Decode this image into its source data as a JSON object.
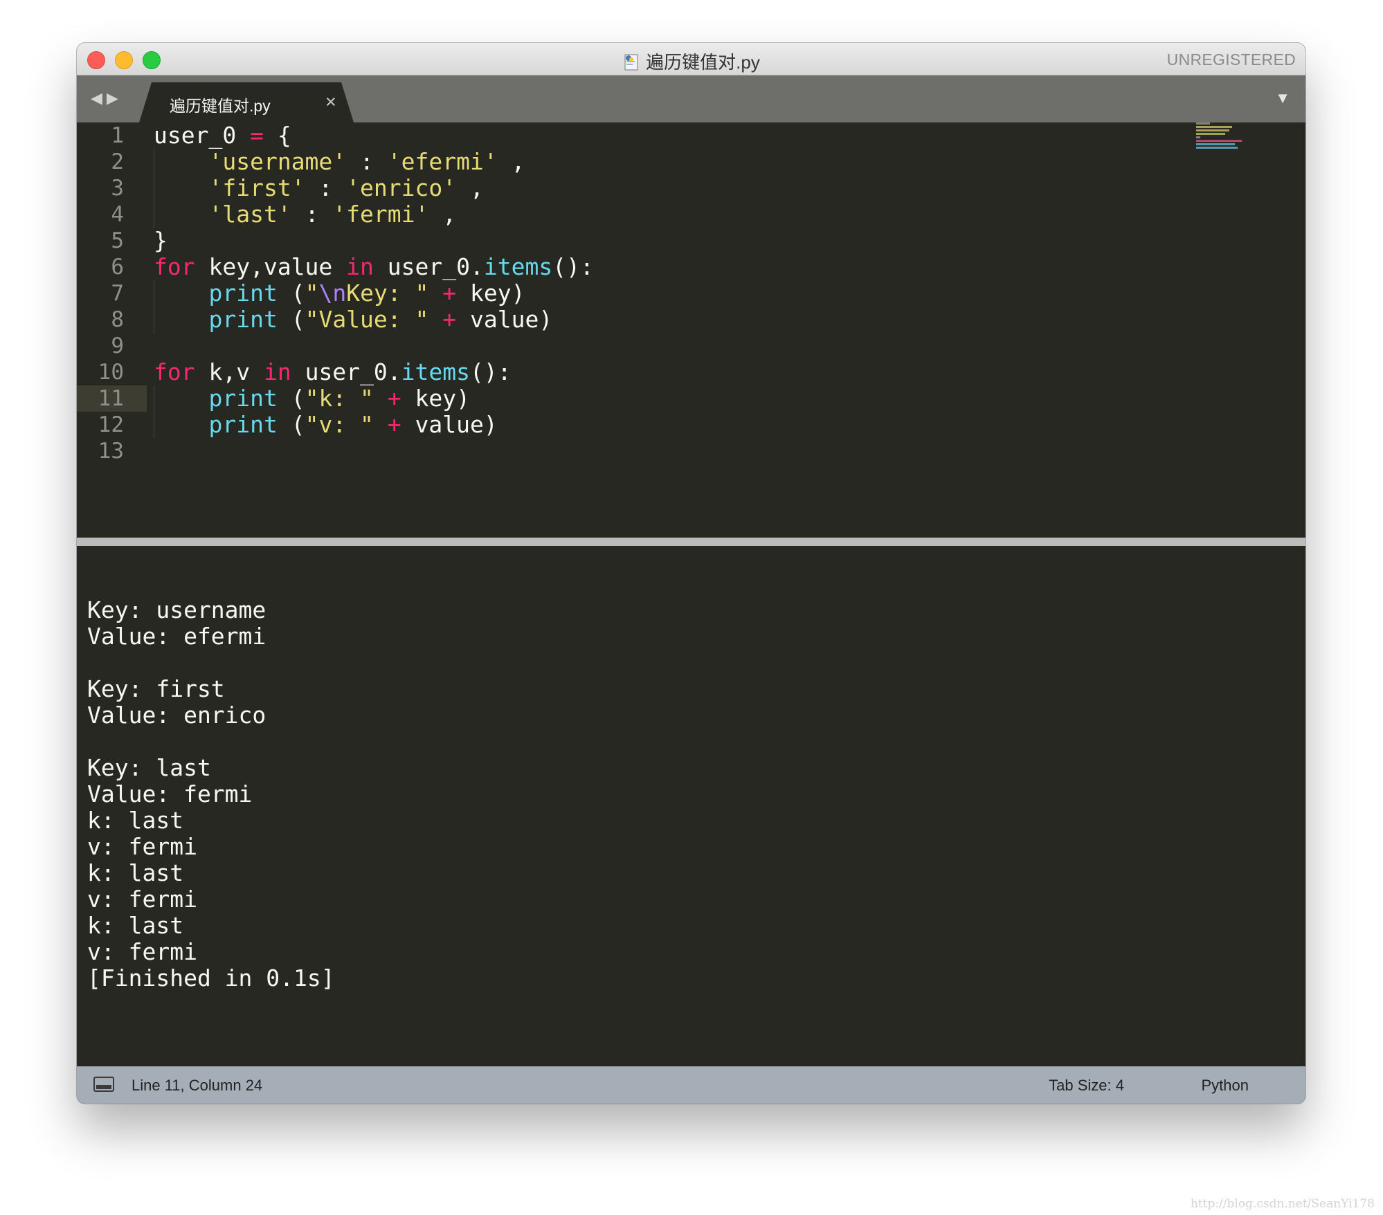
{
  "window": {
    "title": "遍历键值对.py",
    "license_status": "UNREGISTERED"
  },
  "tabs": [
    {
      "label": "遍历键值对.py",
      "active": true
    }
  ],
  "editor": {
    "syntax": "Python",
    "line_numbers": [
      "1",
      "2",
      "3",
      "4",
      "5",
      "6",
      "7",
      "8",
      "9",
      "10",
      "11",
      "12",
      "13"
    ],
    "active_line": 11,
    "colors": {
      "background": "#272822",
      "keyword": "#f92672",
      "string": "#e6db74",
      "builtin": "#66d9ef",
      "escape": "#ae81ff",
      "text": "#f8f8f2"
    },
    "lines": [
      "user_0 = {",
      "    'username' : 'efermi' ,",
      "    'first' : 'enrico' ,",
      "    'last' : 'fermi' ,",
      "}",
      "for key,value in user_0.items():",
      "    print (\"\\nKey: \" + key)",
      "    print (\"Value: \" + value)",
      "",
      "for k,v in user_0.items():",
      "    print (\"k: \" + key)",
      "    print (\"v: \" + value)",
      ""
    ]
  },
  "output": {
    "lines": [
      "",
      "Key: username",
      "Value: efermi",
      "",
      "Key: first",
      "Value: enrico",
      "",
      "Key: last",
      "Value: fermi",
      "k: last",
      "v: fermi",
      "k: last",
      "v: fermi",
      "k: last",
      "v: fermi",
      "[Finished in 0.1s]"
    ]
  },
  "status_bar": {
    "position": "Line 11, Column 24",
    "tab_size": "Tab Size: 4",
    "syntax": "Python"
  },
  "watermark": "http://blog.csdn.net/SeanYi178"
}
